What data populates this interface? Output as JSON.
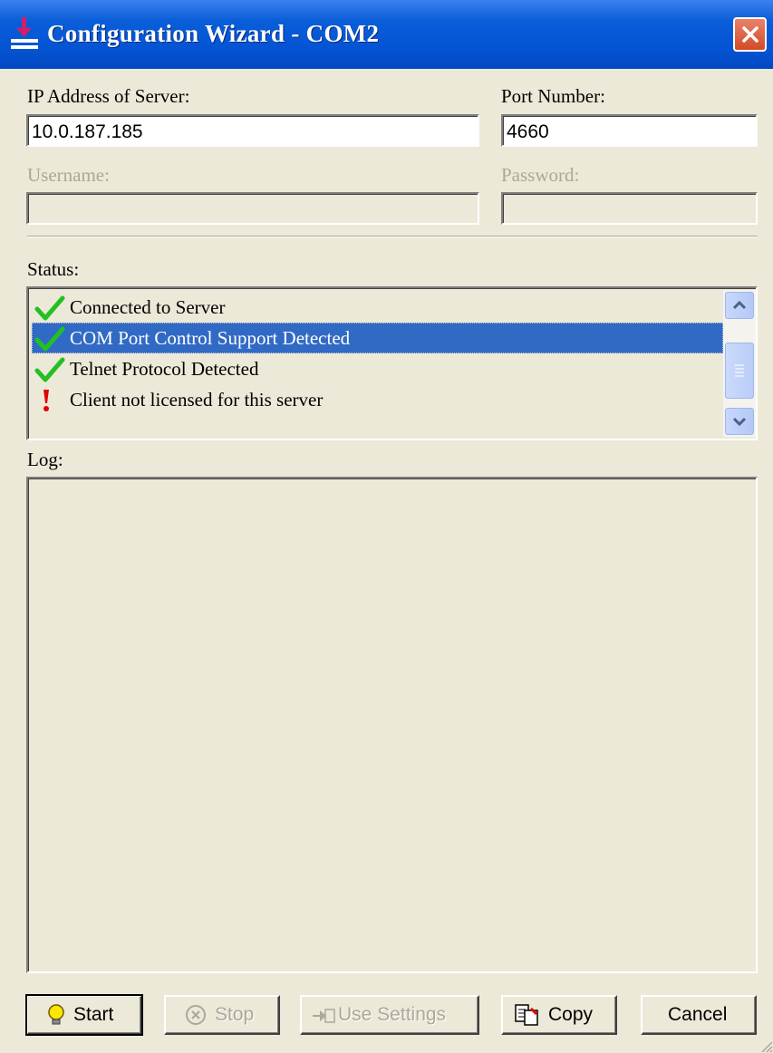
{
  "window": {
    "title": "Configuration Wizard - COM2"
  },
  "fields": {
    "ip_label": "IP Address of Server:",
    "ip_value": "10.0.187.185",
    "port_label": "Port Number:",
    "port_value": "4660",
    "username_label": "Username:",
    "username_value": "",
    "password_label": "Password:",
    "password_value": ""
  },
  "status": {
    "label": "Status:",
    "items": [
      {
        "icon": "check-icon",
        "text": "Connected to Server"
      },
      {
        "icon": "check-icon",
        "text": "COM Port Control Support Detected",
        "selected": true
      },
      {
        "icon": "check-icon",
        "text": "Telnet Protocol Detected"
      },
      {
        "icon": "exclamation-icon",
        "text": "Client not licensed for this server"
      }
    ]
  },
  "log": {
    "label": "Log:",
    "content": ""
  },
  "buttons": {
    "start": "Start",
    "stop": "Stop",
    "use_settings": "Use Settings",
    "copy": "Copy",
    "cancel": "Cancel"
  },
  "colors": {
    "titlebar": "#0454d4",
    "selection": "#316ac5",
    "face": "#ece9d8",
    "check": "#22c022",
    "exclamation": "#e00000"
  }
}
